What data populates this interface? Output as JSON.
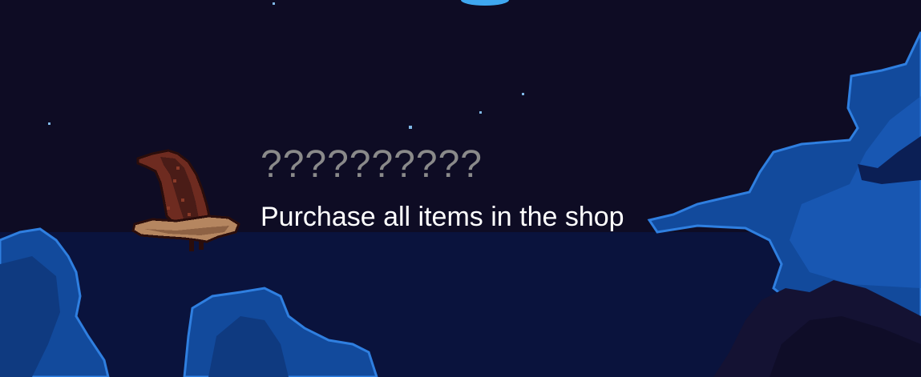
{
  "achievement": {
    "title": "??????????",
    "description": "Purchase all items in the shop",
    "icon": "wizard-hat-icon"
  },
  "colors": {
    "sky": "#0e0c24",
    "cloud_light": "#1e63c4",
    "cloud_mid": "#124a9c",
    "cloud_outline": "#2f7fe0",
    "title_text": "#8a8a8a",
    "description_text": "#ffffff",
    "hat_dark": "#4a1c17",
    "hat_mid": "#6e2b20",
    "hat_brim": "#b58660"
  }
}
